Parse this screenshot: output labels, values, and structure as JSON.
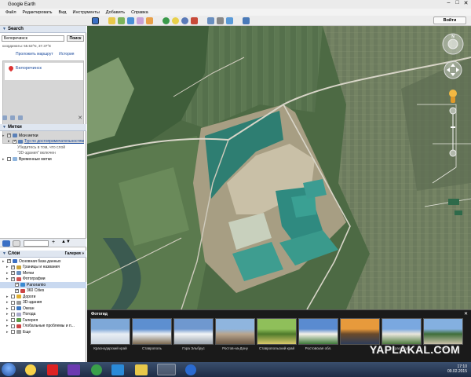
{
  "window": {
    "title": "Google Earth",
    "controls": [
      "–",
      "□",
      "✕"
    ]
  },
  "menu": [
    "Файл",
    "Редактировать",
    "Вид",
    "Инструменты",
    "Добавить",
    "Справка"
  ],
  "toolbar": {
    "signin_label": "Войти"
  },
  "search": {
    "header": "Search",
    "value": "Белоречинск",
    "button": "Поиск",
    "coords": "координаты: 55.53°N, 37.37°E",
    "links": [
      "Проложить маршрут",
      "История"
    ],
    "result": "Белоречинск"
  },
  "places": {
    "header": "Метки",
    "items": [
      {
        "label": "Мои метки",
        "checked": true,
        "style": "normal"
      },
      {
        "label": "Тур по достопримечательностям",
        "checked": true,
        "style": "link"
      },
      {
        "label": "Убедитесь в том, что слой",
        "checked": false,
        "style": "gray"
      },
      {
        "label": "\"3D-здания\" включен",
        "checked": false,
        "style": "gray"
      },
      {
        "label": "Временные метки",
        "checked": false,
        "style": "normal"
      }
    ]
  },
  "layers": {
    "header": "Слои",
    "gallery": "Галерея »",
    "items": [
      {
        "label": "Основная база данных",
        "checked": true,
        "indent": 0,
        "color": "#3a6fc4"
      },
      {
        "label": "Границы и названия",
        "checked": true,
        "indent": 1,
        "color": "#c9a23a"
      },
      {
        "label": "Метки",
        "checked": true,
        "indent": 1,
        "color": "#6a8fbf"
      },
      {
        "label": "Фотографии",
        "checked": true,
        "indent": 1,
        "color": "#d25252"
      },
      {
        "label": "Panoramio",
        "checked": true,
        "indent": 2,
        "color": "#3a8ad2",
        "selected": true
      },
      {
        "label": "360 Cities",
        "checked": true,
        "indent": 2,
        "color": "#c44"
      },
      {
        "label": "Дороги",
        "checked": false,
        "indent": 1,
        "color": "#e0b030"
      },
      {
        "label": "3D-здания",
        "checked": false,
        "indent": 1,
        "color": "#999"
      },
      {
        "label": "Океан",
        "checked": false,
        "indent": 1,
        "color": "#3a78c4"
      },
      {
        "label": "Погода",
        "checked": false,
        "indent": 1,
        "color": "#aac"
      },
      {
        "label": "Галерея",
        "checked": false,
        "indent": 1,
        "color": "#5a9b4a"
      },
      {
        "label": "Глобальные проблемы и п...",
        "checked": false,
        "indent": 1,
        "color": "#c44"
      },
      {
        "label": "Еще",
        "checked": false,
        "indent": 1,
        "color": "#999"
      }
    ]
  },
  "photo_strip": {
    "header": "Фотогид",
    "photos": [
      {
        "caption": "Краснодарский край",
        "colors": [
          "#7ea8d8",
          "#e8eef5",
          "#c8d2dc"
        ]
      },
      {
        "caption": "Ставрополь",
        "colors": [
          "#5d8fd0",
          "#e9eef3",
          "#7d6b52"
        ]
      },
      {
        "caption": "Гора Эльбрус",
        "colors": [
          "#6f98cf",
          "#f3f5f7",
          "#9aa3ad"
        ]
      },
      {
        "caption": "Ростов-на-Дону",
        "colors": [
          "#8fb5de",
          "#b9a58e",
          "#6c5a47"
        ]
      },
      {
        "caption": "Ставропольский край",
        "colors": [
          "#8fbf5a",
          "#4e7a2a",
          "#d9c86b"
        ]
      },
      {
        "caption": "Ростовская обл.",
        "colors": [
          "#5a8bd0",
          "#f4f1ea",
          "#3f7a3a"
        ]
      },
      {
        "caption": "",
        "colors": [
          "#e79a3c",
          "#6b4a2a",
          "#2f3e5a"
        ]
      },
      {
        "caption": "Краснодар",
        "colors": [
          "#7aa8e0",
          "#e9e6dd",
          "#4f7b3f"
        ]
      },
      {
        "caption": "Сочи",
        "colors": [
          "#84b0e0",
          "#3f6e3a",
          "#c9c0a8"
        ]
      }
    ]
  },
  "watermark": "YAPLAKAL.COM",
  "taskbar": {
    "time": "17:10",
    "date": "09.02.2015"
  }
}
